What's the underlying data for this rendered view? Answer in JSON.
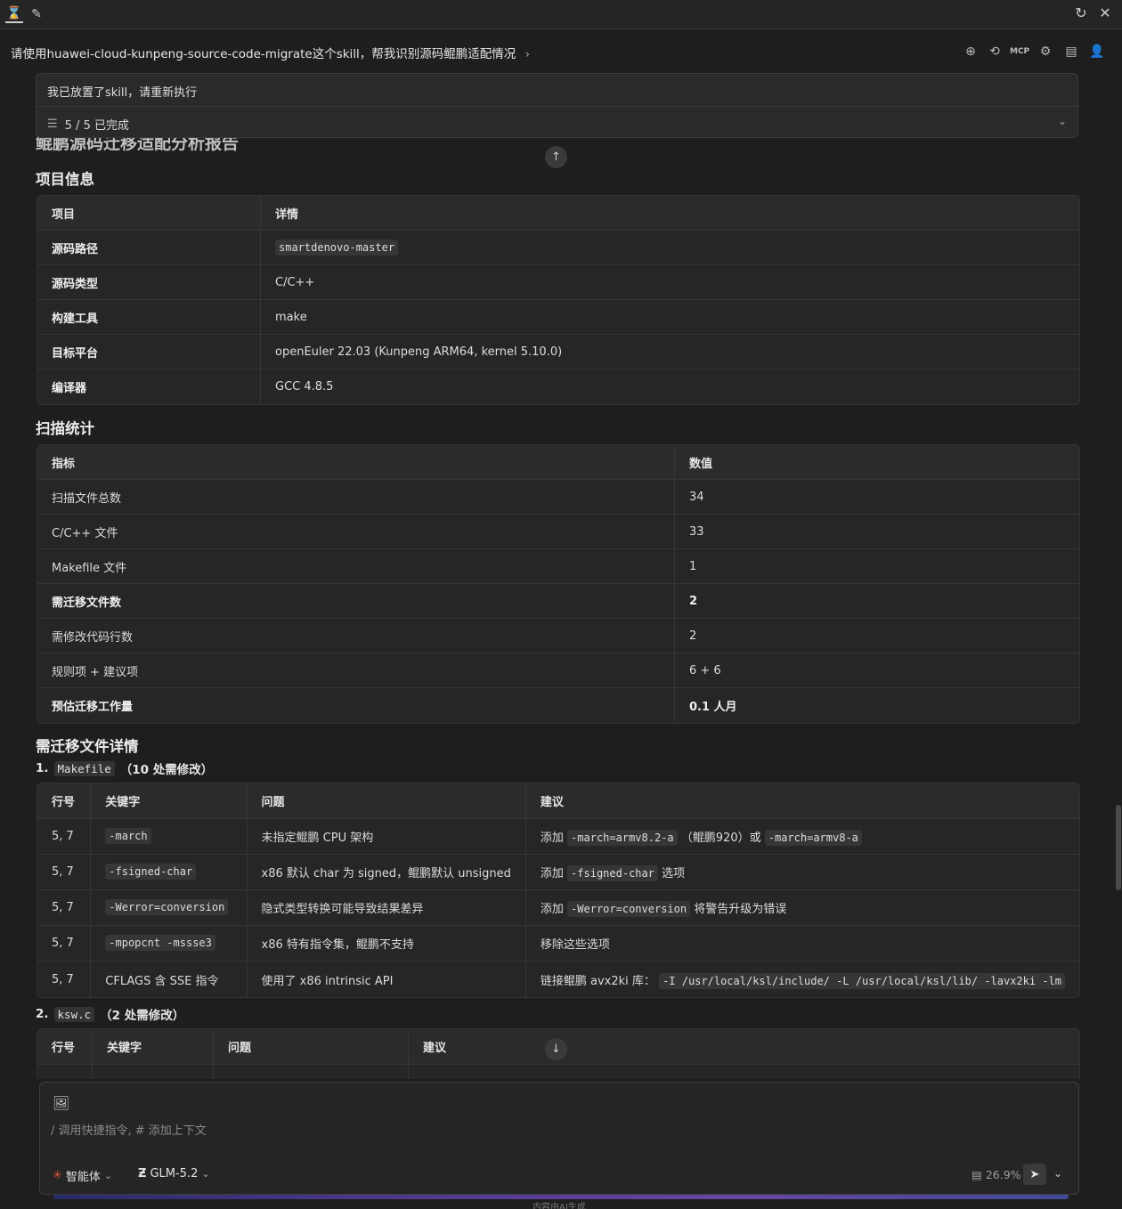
{
  "window": {
    "refresh_icon": "refresh-icon",
    "close_icon": "close-icon"
  },
  "conversation": {
    "title": "请使用huawei-cloud-kunpeng-source-code-migrate这个skill，帮我识别源码鲲鹏适配情况",
    "title_chevron": "›"
  },
  "message_card": {
    "text": "我已放置了skill，请重新执行",
    "progress": "5 / 5 已完成"
  },
  "report": {
    "title": "鲲鹏源码迁移适配分析报告",
    "section_project": "项目信息",
    "project_table": {
      "headers": [
        "项目",
        "详情"
      ],
      "rows": [
        {
          "key": "源码路径",
          "value": "smartdenovo-master",
          "code": true
        },
        {
          "key": "源码类型",
          "value": "C/C++"
        },
        {
          "key": "构建工具",
          "value": "make"
        },
        {
          "key": "目标平台",
          "value": "openEuler 22.03 (Kunpeng ARM64, kernel 5.10.0)"
        },
        {
          "key": "编译器",
          "value": "GCC 4.8.5"
        }
      ]
    },
    "section_stats": "扫描统计",
    "stats_table": {
      "headers": [
        "指标",
        "数值"
      ],
      "rows": [
        {
          "key": "扫描文件总数",
          "value": "34"
        },
        {
          "key": "C/C++ 文件",
          "value": "33"
        },
        {
          "key": "Makefile 文件",
          "value": "1"
        },
        {
          "key": "需迁移文件数",
          "value": "2",
          "bold": true
        },
        {
          "key": "需修改代码行数",
          "value": "2"
        },
        {
          "key": "规则项 + 建议项",
          "value": "6 + 6"
        },
        {
          "key": "预估迁移工作量",
          "value": "0.1 人月",
          "bold": true
        }
      ]
    },
    "section_files": "需迁移文件详情",
    "file1": {
      "index": "1.",
      "name": "Makefile",
      "count": "（10 处需修改）"
    },
    "file1_table": {
      "headers": [
        "行号",
        "关键字",
        "问题",
        "建议"
      ],
      "rows": [
        {
          "line": "5, 7",
          "keyword": "-march",
          "issue": "未指定鲲鹏 CPU 架构",
          "s1": "添加",
          "c1": "-march=armv8.2-a",
          "s2": "（鲲鹏920）或",
          "c2": "-march=armv8-a",
          "s3": ""
        },
        {
          "line": "5, 7",
          "keyword": "-fsigned-char",
          "issue": "x86 默认 char 为 signed，鲲鹏默认 unsigned",
          "s1": "添加",
          "c1": "-fsigned-char",
          "s2": "选项",
          "c2": "",
          "s3": ""
        },
        {
          "line": "5, 7",
          "keyword": "-Werror=conversion",
          "issue": "隐式类型转换可能导致结果差异",
          "s1": "添加",
          "c1": "-Werror=conversion",
          "s2": "将警告升级为错误",
          "c2": "",
          "s3": ""
        },
        {
          "line": "5, 7",
          "keyword": "-mpopcnt -mssse3",
          "issue": "x86 特有指令集，鲲鹏不支持",
          "s1": "移除这些选项",
          "c1": "",
          "s2": "",
          "c2": "",
          "s3": ""
        },
        {
          "line": "5, 7",
          "keyword": "CFLAGS 含 SSE 指令",
          "keyword_plain": true,
          "issue": "使用了 x86 intrinsic API",
          "s1": "链接鲲鹏 avx2ki 库：",
          "c1": "-I /usr/local/ksl/include/ -L /usr/local/ksl/lib/ -lavx2ki -lm",
          "s2": "",
          "c2": "",
          "s3": ""
        }
      ]
    },
    "file2": {
      "index": "2.",
      "name": "ksw.c",
      "count": "（2 处需修改）"
    },
    "file2_table": {
      "headers": [
        "行号",
        "关键字",
        "问题",
        "建议"
      ]
    }
  },
  "input": {
    "placeholder": "/ 调用快捷指令, # 添加上下文",
    "agent_label": "智能体",
    "model_label": "GLM-5.2",
    "usage": "26.9%"
  },
  "footer": {
    "note": "内容由AI生成"
  }
}
